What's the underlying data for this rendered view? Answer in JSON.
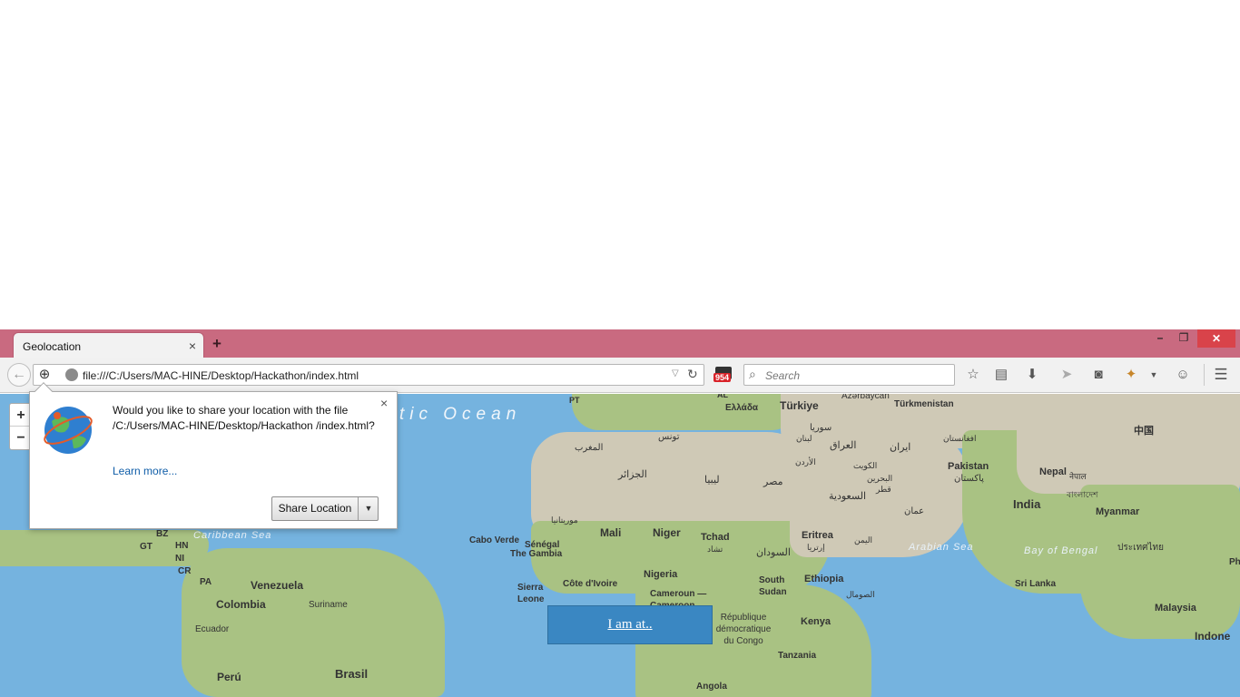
{
  "browser": {
    "tab_title": "Geolocation",
    "tab_close": "×",
    "new_tab": "+",
    "window": {
      "minimize": "–",
      "restore": "❐",
      "close": "✕"
    },
    "url": "file:///C:/Users/MAC-HINE/Desktop/Hackathon/index.html",
    "extension_badge": "954",
    "search_placeholder": "Search",
    "icons": [
      "back-arrow-icon",
      "geolocation-icon",
      "site-identity-icon",
      "dropdown-icon",
      "reload-icon",
      "bookmark-star-icon",
      "reading-list-icon",
      "download-icon",
      "send-icon",
      "pocket-icon",
      "extension-icon",
      "dropdown-icon",
      "chat-icon",
      "menu-icon"
    ]
  },
  "popup": {
    "message": "Would you like to share your location with the file /C:/Users/MAC-HINE/Desktop/Hackathon /index.html?",
    "learn_more": "Learn more...",
    "share_button": "Share Location",
    "close": "×"
  },
  "map": {
    "zoom_in": "+",
    "zoom_out": "−",
    "ocean_label": "tic Ocean",
    "seas": [
      "Caribbean Sea",
      "Arabian Sea",
      "Bay of Bengal"
    ],
    "labels": [
      "PT",
      "AL",
      "Ελλάδα",
      "Türkiye",
      "Azərbaycan",
      "Türkmenistan",
      "中国",
      "تونس",
      "المغرب",
      "الجزائر",
      "ليبيا",
      "مصر",
      "سوريا",
      "لبنان",
      "العراق",
      "ایران",
      "افغانستان",
      "الأردن",
      "الكويت",
      "البحرين",
      "قطر",
      "السعودية",
      "عمان",
      "Pakistan",
      "پاکستان",
      "Nepal",
      "नेपाल",
      "বাংলাদেশ",
      "India",
      "Myanmar",
      "ประเทศไทย",
      "موريتانيا",
      "Mali",
      "Niger",
      "Tchad",
      "تشاد",
      "السودان",
      "Eritrea",
      "إرتريا",
      "اليمن",
      "Cabo Verde",
      "Sénégal",
      "The Gambia",
      "Nigeria",
      "Sierra Leone",
      "Côte d'Ivoire",
      "South Sudan",
      "Ethiopia",
      "الصومال",
      "Cameroun — Cameroon",
      "République démocratique du Congo",
      "Kenya",
      "Tanzania",
      "Angola",
      "Sri Lanka",
      "Malaysia",
      "Indone",
      "BZ",
      "GT",
      "HN",
      "NI",
      "CR",
      "PA",
      "Venezuela",
      "Colombia",
      "Suriname",
      "Ecuador",
      "Perú",
      "Brasil",
      "Phi"
    ],
    "button": "I am at.."
  }
}
